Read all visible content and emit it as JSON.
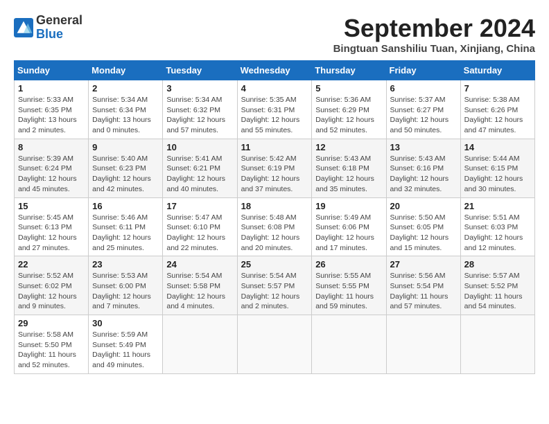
{
  "header": {
    "logo_general": "General",
    "logo_blue": "Blue",
    "month_title": "September 2024",
    "location": "Bingtuan Sanshiliu Tuan, Xinjiang, China"
  },
  "calendar": {
    "headers": [
      "Sunday",
      "Monday",
      "Tuesday",
      "Wednesday",
      "Thursday",
      "Friday",
      "Saturday"
    ],
    "weeks": [
      [
        {
          "day": "",
          "info": ""
        },
        {
          "day": "2",
          "info": "Sunrise: 5:34 AM\nSunset: 6:34 PM\nDaylight: 13 hours\nand 0 minutes."
        },
        {
          "day": "3",
          "info": "Sunrise: 5:34 AM\nSunset: 6:32 PM\nDaylight: 12 hours\nand 57 minutes."
        },
        {
          "day": "4",
          "info": "Sunrise: 5:35 AM\nSunset: 6:31 PM\nDaylight: 12 hours\nand 55 minutes."
        },
        {
          "day": "5",
          "info": "Sunrise: 5:36 AM\nSunset: 6:29 PM\nDaylight: 12 hours\nand 52 minutes."
        },
        {
          "day": "6",
          "info": "Sunrise: 5:37 AM\nSunset: 6:27 PM\nDaylight: 12 hours\nand 50 minutes."
        },
        {
          "day": "7",
          "info": "Sunrise: 5:38 AM\nSunset: 6:26 PM\nDaylight: 12 hours\nand 47 minutes."
        }
      ],
      [
        {
          "day": "8",
          "info": "Sunrise: 5:39 AM\nSunset: 6:24 PM\nDaylight: 12 hours\nand 45 minutes."
        },
        {
          "day": "9",
          "info": "Sunrise: 5:40 AM\nSunset: 6:23 PM\nDaylight: 12 hours\nand 42 minutes."
        },
        {
          "day": "10",
          "info": "Sunrise: 5:41 AM\nSunset: 6:21 PM\nDaylight: 12 hours\nand 40 minutes."
        },
        {
          "day": "11",
          "info": "Sunrise: 5:42 AM\nSunset: 6:19 PM\nDaylight: 12 hours\nand 37 minutes."
        },
        {
          "day": "12",
          "info": "Sunrise: 5:43 AM\nSunset: 6:18 PM\nDaylight: 12 hours\nand 35 minutes."
        },
        {
          "day": "13",
          "info": "Sunrise: 5:43 AM\nSunset: 6:16 PM\nDaylight: 12 hours\nand 32 minutes."
        },
        {
          "day": "14",
          "info": "Sunrise: 5:44 AM\nSunset: 6:15 PM\nDaylight: 12 hours\nand 30 minutes."
        }
      ],
      [
        {
          "day": "15",
          "info": "Sunrise: 5:45 AM\nSunset: 6:13 PM\nDaylight: 12 hours\nand 27 minutes."
        },
        {
          "day": "16",
          "info": "Sunrise: 5:46 AM\nSunset: 6:11 PM\nDaylight: 12 hours\nand 25 minutes."
        },
        {
          "day": "17",
          "info": "Sunrise: 5:47 AM\nSunset: 6:10 PM\nDaylight: 12 hours\nand 22 minutes."
        },
        {
          "day": "18",
          "info": "Sunrise: 5:48 AM\nSunset: 6:08 PM\nDaylight: 12 hours\nand 20 minutes."
        },
        {
          "day": "19",
          "info": "Sunrise: 5:49 AM\nSunset: 6:06 PM\nDaylight: 12 hours\nand 17 minutes."
        },
        {
          "day": "20",
          "info": "Sunrise: 5:50 AM\nSunset: 6:05 PM\nDaylight: 12 hours\nand 15 minutes."
        },
        {
          "day": "21",
          "info": "Sunrise: 5:51 AM\nSunset: 6:03 PM\nDaylight: 12 hours\nand 12 minutes."
        }
      ],
      [
        {
          "day": "22",
          "info": "Sunrise: 5:52 AM\nSunset: 6:02 PM\nDaylight: 12 hours\nand 9 minutes."
        },
        {
          "day": "23",
          "info": "Sunrise: 5:53 AM\nSunset: 6:00 PM\nDaylight: 12 hours\nand 7 minutes."
        },
        {
          "day": "24",
          "info": "Sunrise: 5:54 AM\nSunset: 5:58 PM\nDaylight: 12 hours\nand 4 minutes."
        },
        {
          "day": "25",
          "info": "Sunrise: 5:54 AM\nSunset: 5:57 PM\nDaylight: 12 hours\nand 2 minutes."
        },
        {
          "day": "26",
          "info": "Sunrise: 5:55 AM\nSunset: 5:55 PM\nDaylight: 11 hours\nand 59 minutes."
        },
        {
          "day": "27",
          "info": "Sunrise: 5:56 AM\nSunset: 5:54 PM\nDaylight: 11 hours\nand 57 minutes."
        },
        {
          "day": "28",
          "info": "Sunrise: 5:57 AM\nSunset: 5:52 PM\nDaylight: 11 hours\nand 54 minutes."
        }
      ],
      [
        {
          "day": "29",
          "info": "Sunrise: 5:58 AM\nSunset: 5:50 PM\nDaylight: 11 hours\nand 52 minutes."
        },
        {
          "day": "30",
          "info": "Sunrise: 5:59 AM\nSunset: 5:49 PM\nDaylight: 11 hours\nand 49 minutes."
        },
        {
          "day": "",
          "info": ""
        },
        {
          "day": "",
          "info": ""
        },
        {
          "day": "",
          "info": ""
        },
        {
          "day": "",
          "info": ""
        },
        {
          "day": "",
          "info": ""
        }
      ]
    ],
    "week1_day1": {
      "day": "1",
      "info": "Sunrise: 5:33 AM\nSunset: 6:35 PM\nDaylight: 13 hours\nand 2 minutes."
    }
  }
}
